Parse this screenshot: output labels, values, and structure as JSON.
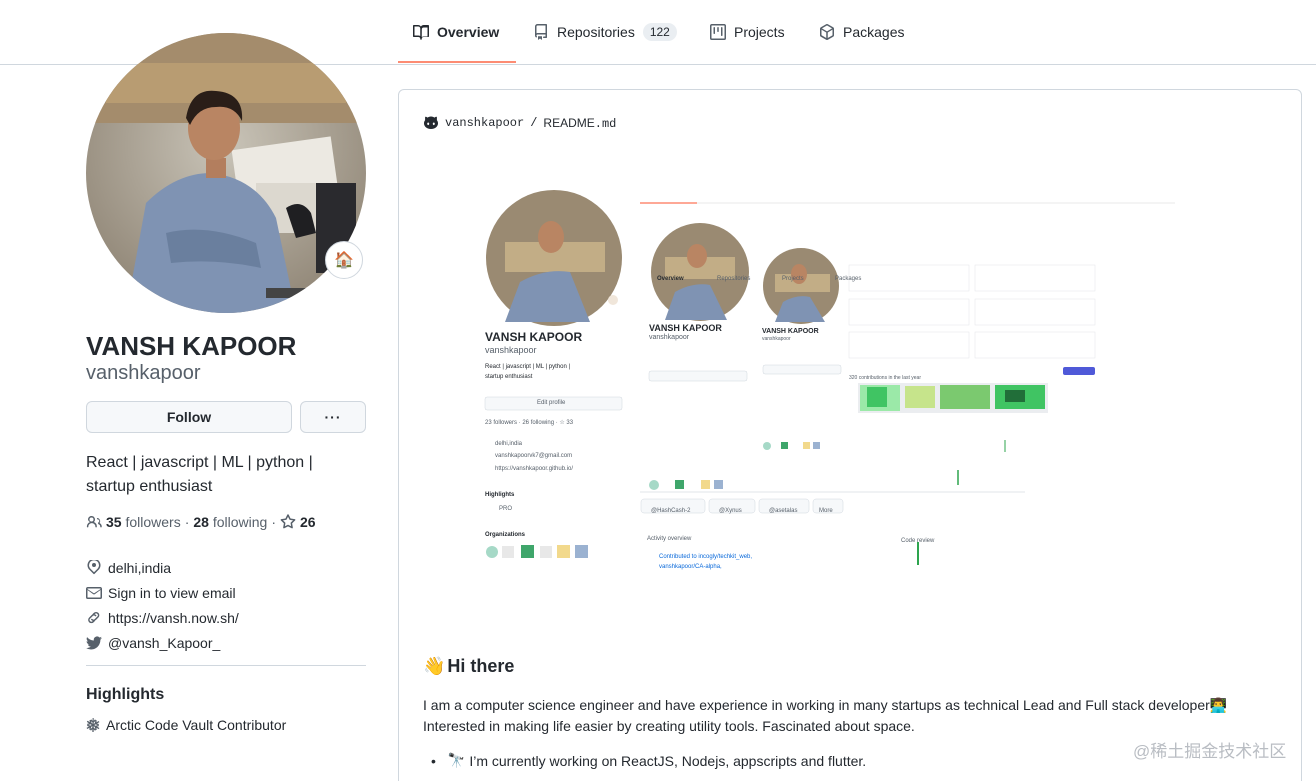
{
  "nav": {
    "tabs": [
      {
        "label": "Overview",
        "icon": "book-icon",
        "active": true
      },
      {
        "label": "Repositories",
        "icon": "repo-icon",
        "count": "122"
      },
      {
        "label": "Projects",
        "icon": "project-icon"
      },
      {
        "label": "Packages",
        "icon": "package-icon"
      }
    ]
  },
  "profile": {
    "status_emoji": "🏠",
    "fullname": "VANSH KAPOOR",
    "username": "vanshkapoor",
    "follow_label": "Follow",
    "more_label": "···",
    "bio": "React | javascript | ML | python | startup enthusiast",
    "followers_count": "35",
    "followers_label": "followers",
    "following_count": "28",
    "following_label": "following",
    "stars_count": "26",
    "location": "delhi,india",
    "email": "Sign in to view email",
    "website": "https://vansh.now.sh/",
    "twitter": "@vansh_Kapoor_"
  },
  "highlights": {
    "title": "Highlights",
    "item": "Arctic Code Vault Contributor"
  },
  "readme": {
    "path_user": "vanshkapoor",
    "path_sep": "/",
    "path_file": "README",
    "path_ext": ".md",
    "greeting_emoji": "👋",
    "greeting": "Hi there",
    "paragraph_1": "I am a computer science engineer and have experience in working in many startups as technical Lead and Full stack developer",
    "paragraph_1_emoji": "👨‍💻",
    "paragraph_2": "Interested in making life easier by creating utility tools. Fascinated about space.",
    "bullet_1_emoji": "🔭",
    "bullet_1": "I’m currently working on ReactJS, Nodejs, appscripts and flutter."
  },
  "embedded_screenshot": {
    "tabs": [
      "Overview",
      "Repositories",
      "Projects",
      "Packages"
    ],
    "big_name": "VANSH KAPOOR",
    "big_user": "vanshkapoor",
    "big_bio_1": "React | javascript | ML | python |",
    "big_bio_2": "startup enthusiast",
    "edit_profile": "Edit profile",
    "big_followers": "23 followers · 26 following · ☆ 33",
    "big_location": "delhi,india",
    "big_email": "vanshkapoorvk7@gmail.com",
    "big_site": "https://vanshkapoor.github.io/",
    "highlights": "Highlights",
    "pro": "PRO",
    "organizations": "Organizations",
    "chips": [
      "@HashCash-2",
      "@Xynus",
      "@asetalas",
      "More"
    ],
    "activity": "Activity overview",
    "contrib_1": "Contributed to incogly/techkit_web,",
    "contrib_2": "vanshkapoor/CA-alpha,",
    "code_review": "Code review",
    "mid_name": "VANSH KAPOOR",
    "mid_user": "vanshkapoor",
    "small_name": "VANSH KAPOOR",
    "small_user": "vanshkapoor",
    "contributions": "320 contributions in the last year"
  },
  "watermark": "@稀土掘金技术社区",
  "colors": {
    "accent_underline": "#fd8c73",
    "border": "#d0d7de",
    "text": "#24292f",
    "muted": "#57606a",
    "green": "#40c463"
  }
}
